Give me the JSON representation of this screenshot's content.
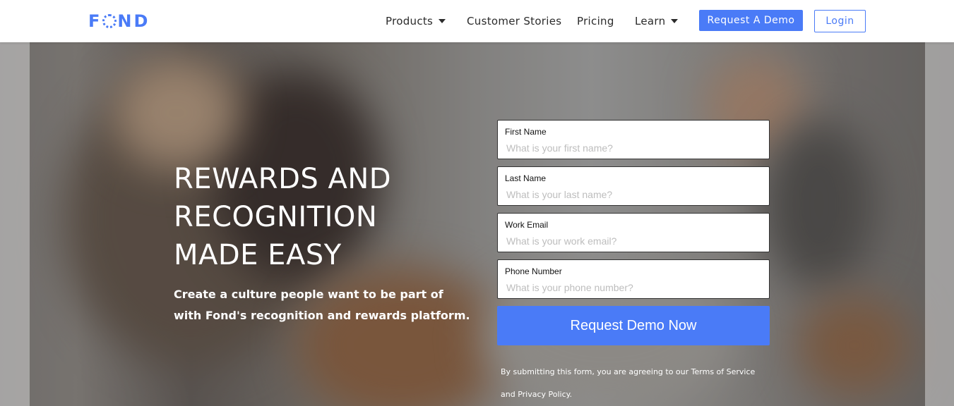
{
  "colors": {
    "accent": "#4a7bf7",
    "header_bg": "#ffffff",
    "nav_text": "#2b2b2b"
  },
  "brand": {
    "logo_text": "FOND"
  },
  "nav": {
    "products": "Products",
    "customer_stories": "Customer Stories",
    "pricing": "Pricing",
    "learn": "Learn",
    "request_demo": "Request A Demo",
    "login": "Login"
  },
  "hero": {
    "headline": [
      "REWARDS AND",
      "RECOGNITION",
      "MADE EASY"
    ],
    "subtext": "Create a culture people want to be part of with Fond's recognition and rewards platform."
  },
  "form": {
    "fields": [
      {
        "label": "First Name",
        "placeholder": "What is your first name?",
        "value": ""
      },
      {
        "label": "Last Name",
        "placeholder": "What is your last name?",
        "value": ""
      },
      {
        "label": "Work Email",
        "placeholder": "What is your work email?",
        "value": ""
      },
      {
        "label": "Phone Number",
        "placeholder": "What is your phone number?",
        "value": ""
      }
    ],
    "submit_label": "Request Demo Now",
    "disclaimer": "By submitting this form, you are agreeing to our Terms of Service and Privacy Policy."
  },
  "icons": {
    "dropdown": "caret-down-icon"
  }
}
